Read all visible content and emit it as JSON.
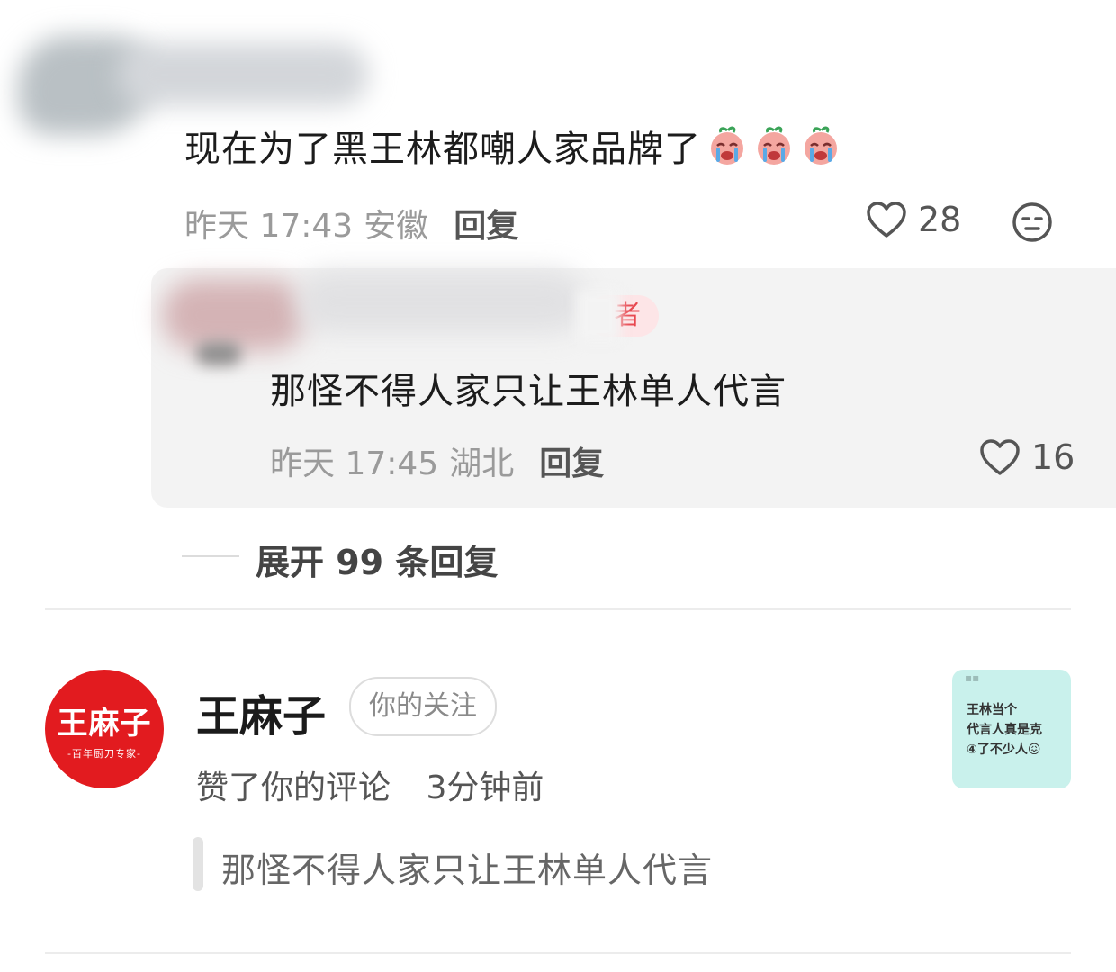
{
  "comment": {
    "text": "现在为了黑王林都嘲人家品牌了",
    "emojis": [
      "crying-emoji",
      "crying-emoji",
      "crying-emoji"
    ],
    "time": "昨天 17:43",
    "location": "安徽",
    "reply_label": "回复",
    "likes": "28"
  },
  "sub_reply": {
    "author_tag": "者",
    "text": "那怪不得人家只让王林单人代言",
    "time": "昨天 17:45",
    "location": "湖北",
    "reply_label": "回复",
    "likes": "16"
  },
  "expand": {
    "label": "展开 99 条回复"
  },
  "notification": {
    "avatar_name": "王麻子",
    "avatar_slogan": "-百年厨刀专家-",
    "user_name": "王麻子",
    "follow_badge": "你的关注",
    "action": "赞了你的评论",
    "time": "3分钟前",
    "quote": "那怪不得人家只让王林单人代言",
    "thumbnail_lines": [
      "王林当个",
      "代言人真是克",
      "④了不少人😖"
    ]
  },
  "colors": {
    "accent_red": "#e21b1f",
    "author_tag_bg": "#fde5e7",
    "thumbnail_bg": "#c9f1ec"
  }
}
